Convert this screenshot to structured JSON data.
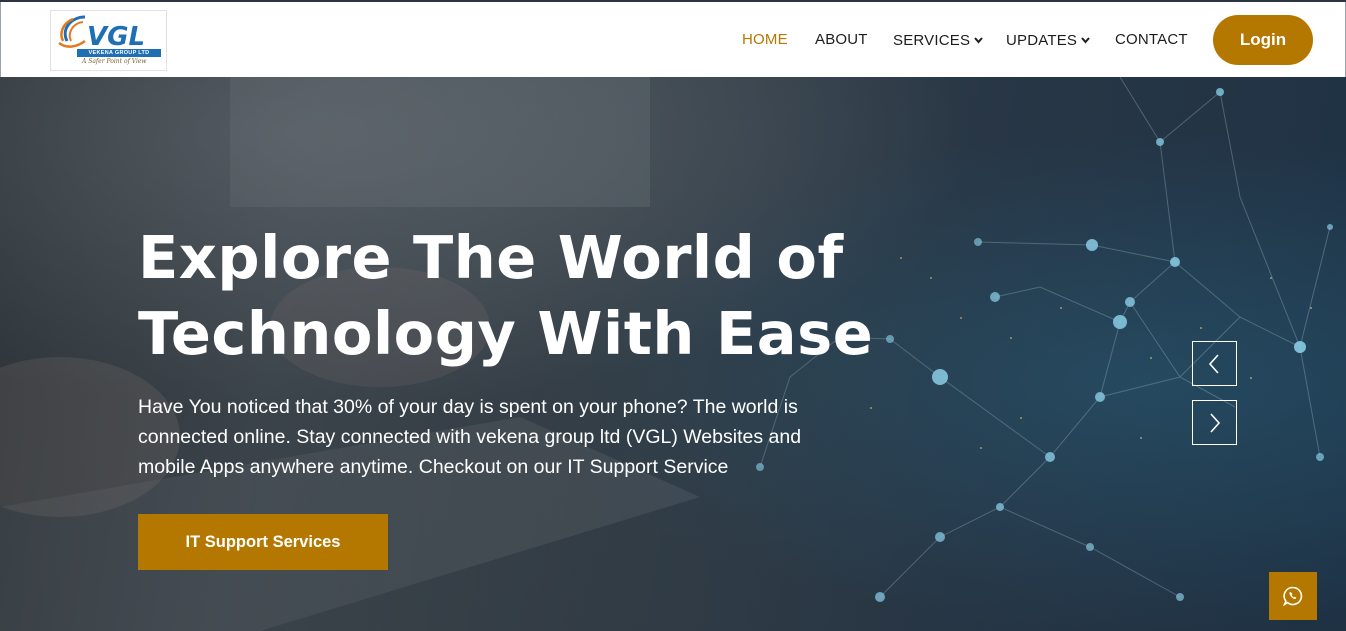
{
  "brand": {
    "logo_text": "VGL",
    "logo_subtitle": "VEKENA GROUP LTD",
    "logo_tagline": "A Safer Point of View"
  },
  "nav": {
    "items": [
      {
        "label": "HOME",
        "active": true,
        "has_dropdown": false
      },
      {
        "label": "ABOUT",
        "active": false,
        "has_dropdown": false
      },
      {
        "label": "SERVICES",
        "active": false,
        "has_dropdown": true
      },
      {
        "label": "UPDATES",
        "active": false,
        "has_dropdown": true
      },
      {
        "label": "CONTACT",
        "active": false,
        "has_dropdown": false
      }
    ],
    "login_label": "Login"
  },
  "hero": {
    "title_line1": "Explore The World of",
    "title_line2": "Technology With Ease",
    "description_line1": "Have You noticed that 30% of your day is spent on your phone? The world is",
    "description_line2": "connected online. Stay connected with vekena group ltd (VGL) Websites and",
    "description_line3": "mobile Apps anywhere anytime. Checkout on our IT Support Service",
    "cta_label": "IT Support Services",
    "prev_icon": "chevron-left-icon",
    "next_icon": "chevron-right-icon"
  },
  "floating": {
    "whatsapp_icon": "whatsapp-icon"
  },
  "colors": {
    "accent": "#b47800",
    "active_nav": "#b57800",
    "nav_text": "#1d1d1d",
    "hero_text": "#ffffff"
  }
}
